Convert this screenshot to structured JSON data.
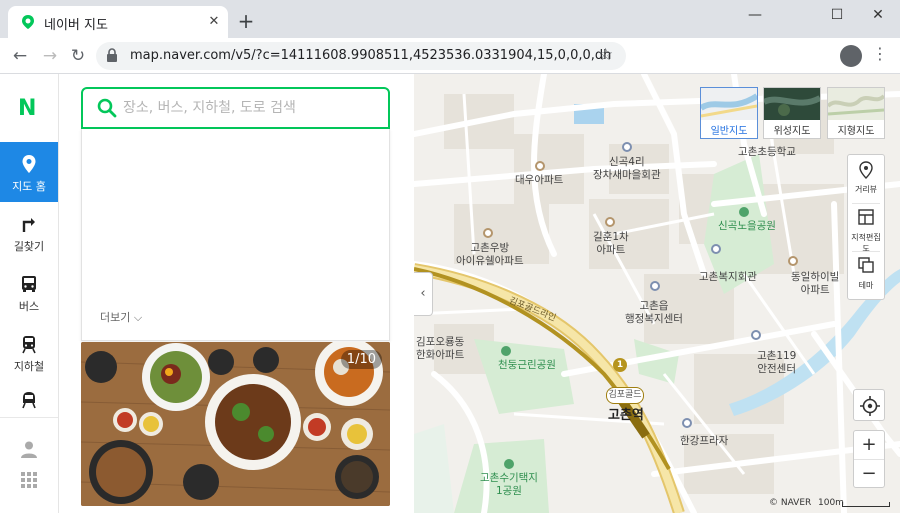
{
  "browser": {
    "tab_title": "네이버 지도",
    "tab_close": "✕",
    "new_tab": "+",
    "url": "map.naver.com/v5/?c=14111608.9908511,4523536.0331904,15,0,0,0,dh",
    "window_controls": [
      "—",
      "☐",
      "✕"
    ]
  },
  "leftnav": {
    "brand": "N",
    "items": [
      {
        "label": "지도 홈",
        "icon": "map-pin-icon",
        "active": true
      },
      {
        "label": "길찾기",
        "icon": "directions-icon",
        "active": false
      },
      {
        "label": "버스",
        "icon": "bus-icon",
        "active": false
      },
      {
        "label": "지하철",
        "icon": "subway-icon",
        "active": false
      },
      {
        "label": "",
        "icon": "train-icon",
        "active": false
      }
    ],
    "bottom_icons": [
      "user-icon",
      "grid-icon"
    ]
  },
  "search": {
    "placeholder": "장소, 버스, 지하철, 도로 검색",
    "more_label": "더보기 ⌵",
    "photo_counter": "1/10"
  },
  "map": {
    "map_types": [
      {
        "label": "일반지도",
        "active": true
      },
      {
        "label": "위성지도",
        "active": false
      },
      {
        "label": "지형지도",
        "active": false
      }
    ],
    "tools": [
      "거리뷰",
      "지적편집도",
      "테마"
    ],
    "zoom_in": "+",
    "zoom_out": "−",
    "attribution": "© NAVER",
    "scale": "100m",
    "collapse": "‹",
    "road_label": "김포골드라인",
    "station": {
      "line_badge": "김포골드",
      "number": "1",
      "name": "고촌역"
    },
    "places": [
      {
        "text": "고촌초등학교",
        "kind": "gray"
      },
      {
        "text": "신곡4리\n장차새마을회관",
        "kind": "blue"
      },
      {
        "text": "대우아파트",
        "kind": "brown"
      },
      {
        "text": "신곡노을공원",
        "kind": "green"
      },
      {
        "text": "길훈1차\n아파트",
        "kind": "brown"
      },
      {
        "text": "고촌우방\n아이유쉘아파트",
        "kind": "brown"
      },
      {
        "text": "고촌복지회관",
        "kind": "blue"
      },
      {
        "text": "동일하이빌\n아파트",
        "kind": "brown"
      },
      {
        "text": "고촌읍\n행정복지센터",
        "kind": "blue"
      },
      {
        "text": "김포오룡동\n한화아파트",
        "kind": "gray"
      },
      {
        "text": "천둥근린공원",
        "kind": "green"
      },
      {
        "text": "고촌119\n안전센터",
        "kind": "blue"
      },
      {
        "text": "한강프라자",
        "kind": "blue"
      },
      {
        "text": "고촌수기택지\n1공원",
        "kind": "green"
      }
    ]
  }
}
